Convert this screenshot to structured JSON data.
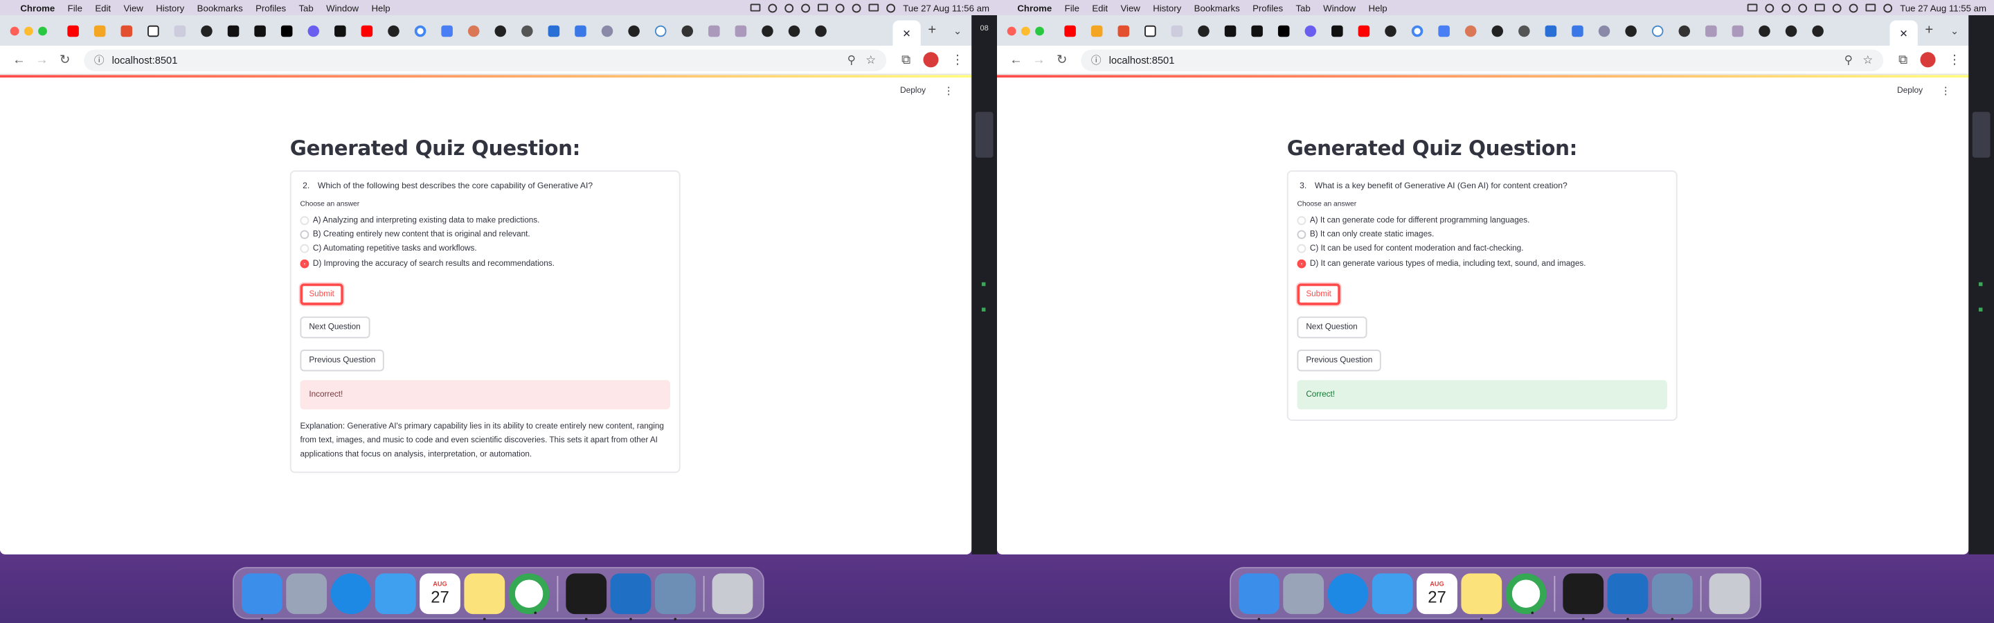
{
  "menubar": {
    "app": "Chrome",
    "items": [
      "File",
      "Edit",
      "View",
      "History",
      "Bookmarks",
      "Profiles",
      "Tab",
      "Window",
      "Help"
    ],
    "left_clock": "Tue 27 Aug  11:56 am",
    "right_clock": "Tue 27 Aug  11:55 am"
  },
  "browser": {
    "url": "localhost:8501",
    "active_tab_close": "✕",
    "new_tab": "+"
  },
  "streamlit": {
    "deploy_label": "Deploy",
    "menu_icon": "⋮"
  },
  "left": {
    "title": "Generated Quiz Question:",
    "question_number": "2.",
    "question": "Which of the following best describes the core capability of Generative AI?",
    "choose_label": "Choose an answer",
    "options": [
      "A) Analyzing and interpreting existing data to make predictions.",
      "B) Creating entirely new content that is original and relevant.",
      "C) Automating repetitive tasks and workflows.",
      "D) Improving the accuracy of search results and recommendations."
    ],
    "selected_index": 3,
    "submit_label": "Submit",
    "next_label": "Next Question",
    "prev_label": "Previous Question",
    "result": "Incorrect!",
    "explanation": "Explanation: Generative AI's primary capability lies in its ability to create entirely new content, ranging from text, images, and music to code and even scientific discoveries. This sets it apart from other AI applications that focus on analysis, interpretation, or automation."
  },
  "right": {
    "title": "Generated Quiz Question:",
    "question_number": "3.",
    "question": "What is a key benefit of Generative AI (Gen AI) for content creation?",
    "choose_label": "Choose an answer",
    "options": [
      "A) It can generate code for different programming languages.",
      "B) It can only create static images.",
      "C) It can be used for content moderation and fact-checking.",
      "D) It can generate various types of media, including text, sound, and images."
    ],
    "selected_index": 3,
    "submit_label": "Submit",
    "next_label": "Next Question",
    "prev_label": "Previous Question",
    "result": "Correct!"
  },
  "dock": {
    "calendar_month": "AUG",
    "calendar_day": "27"
  },
  "colors": {
    "accent": "#ff4b4b",
    "error_bg": "#fde7e8",
    "success_bg": "#e2f4e6"
  }
}
